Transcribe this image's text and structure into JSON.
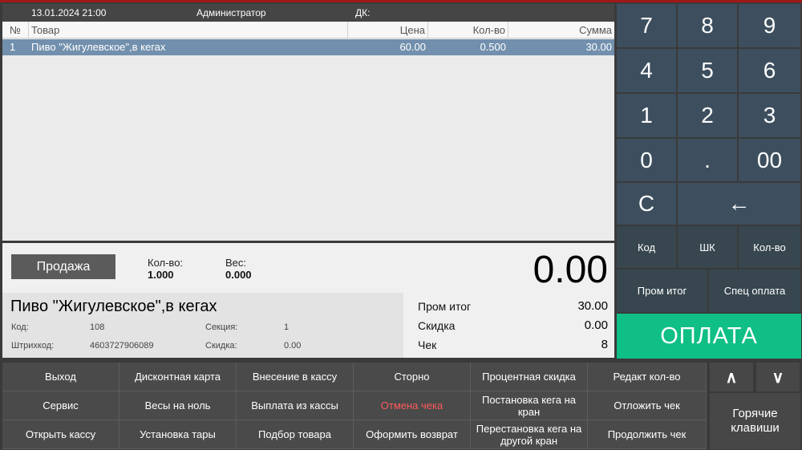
{
  "status": {
    "datetime": "13.01.2024 21:00",
    "user": "Администратор",
    "dk_label": "ДК:"
  },
  "table": {
    "headers": {
      "no": "№",
      "name": "Товар",
      "price": "Цена",
      "qty": "Кол-во",
      "sum": "Сумма"
    },
    "rows": [
      {
        "no": "1",
        "name": "Пиво \"Жигулевское\",в кегах",
        "price": "60.00",
        "qty": "0.500",
        "sum": "30.00"
      }
    ]
  },
  "info": {
    "mode_label": "Продажа",
    "qty_label": "Кол-во:",
    "qty_value": "1.000",
    "weight_label": "Вес:",
    "weight_value": "0.000",
    "display_total": "0.00",
    "product_name": "Пиво \"Жигулевское\",в кегах",
    "code_label": "Код:",
    "code_value": "108",
    "section_label": "Секция:",
    "section_value": "1",
    "barcode_label": "Штрихкод:",
    "barcode_value": "4603727906089",
    "discount_label": "Скидка:",
    "discount_value": "0.00",
    "subtotal_label": "Пром итог",
    "subtotal_value": "30.00",
    "sum_discount_label": "Скидка",
    "sum_discount_value": "0.00",
    "check_label": "Чек",
    "check_value": "8"
  },
  "keypad": {
    "digits": [
      "7",
      "8",
      "9",
      "4",
      "5",
      "6",
      "1",
      "2",
      "3",
      "0",
      ".",
      "00"
    ],
    "clear": "C",
    "backspace": "←",
    "code": "Код",
    "barcode": "ШК",
    "qty": "Кол-во",
    "subtotal": "Пром итог",
    "special_payment": "Спец оплата",
    "pay": "ОПЛАТА"
  },
  "functions": {
    "row1": [
      "Выход",
      "Дисконтная карта",
      "Внесение в кассу",
      "Сторно",
      "Процентная скидка",
      "Редакт кол-во"
    ],
    "row2": [
      "Сервис",
      "Весы на ноль",
      "Выплата из кассы",
      "Отмена чека",
      "Постановка кега на кран",
      "Отложить чек"
    ],
    "row3": [
      "Открыть кассу",
      "Установка тары",
      "Подбор товара",
      "Оформить возврат",
      "Перестановка кега на другой кран",
      "Продолжить чек"
    ],
    "up": "∧",
    "down": "∨",
    "hotkeys": "Горячие клавиши",
    "cancel_color": "#ff5a5a"
  }
}
